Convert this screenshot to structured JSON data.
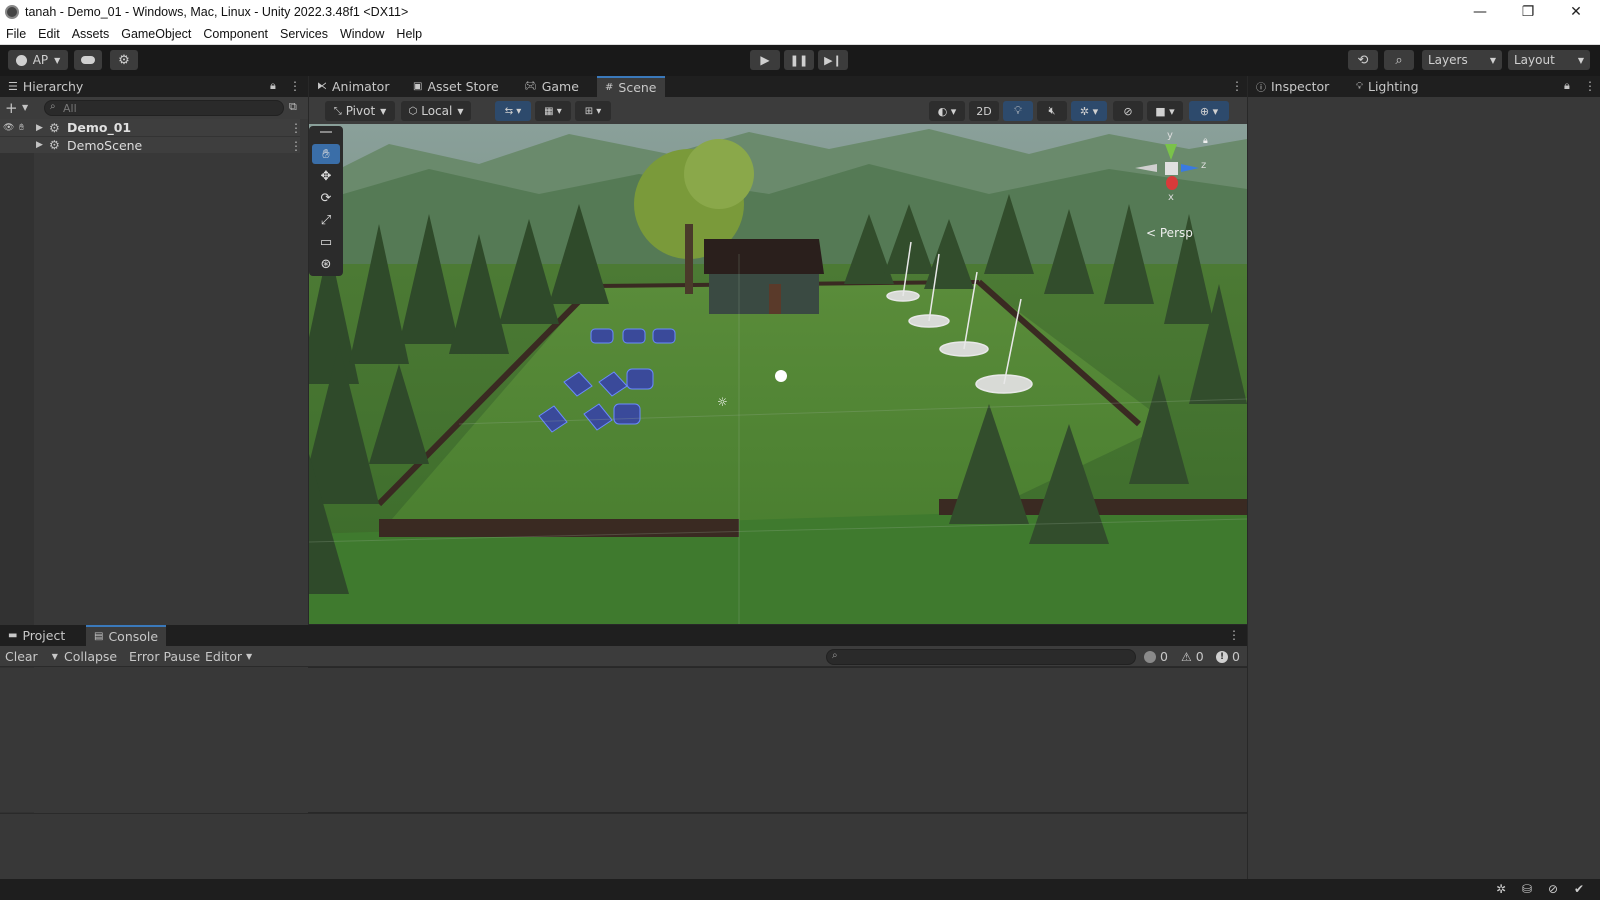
{
  "window": {
    "title": "tanah - Demo_01 - Windows, Mac, Linux - Unity 2022.3.48f1 <DX11>",
    "minimize": "—",
    "maximize": "❐",
    "close": "✕"
  },
  "menu": [
    "File",
    "Edit",
    "Assets",
    "GameObject",
    "Component",
    "Services",
    "Window",
    "Help"
  ],
  "toolbar": {
    "account": "AP",
    "layers": "Layers",
    "layout": "Layout"
  },
  "hierarchy": {
    "tab": "Hierarchy",
    "search_placeholder": "All",
    "items": [
      {
        "label": "Demo_01"
      },
      {
        "label": "DemoScene"
      }
    ]
  },
  "center_tabs": [
    "Animator",
    "Asset Store",
    "Game",
    "Scene"
  ],
  "scene_toolbar": {
    "pivot": "Pivot",
    "local": "Local",
    "mode_2d": "2D"
  },
  "gizmo": {
    "y": "y",
    "x": "x",
    "z": "z",
    "persp": "Persp"
  },
  "right_tabs": [
    "Inspector",
    "Lighting"
  ],
  "bottom_tabs": [
    "Project",
    "Console"
  ],
  "console": {
    "clear": "Clear",
    "collapse": "Collapse",
    "error_pause": "Error Pause",
    "editor": "Editor",
    "log_count": "0",
    "warn_count": "0",
    "error_count": "0"
  },
  "colors": {
    "accent": "#3a79bb",
    "panel": "#383838",
    "toolbar": "#191919"
  }
}
